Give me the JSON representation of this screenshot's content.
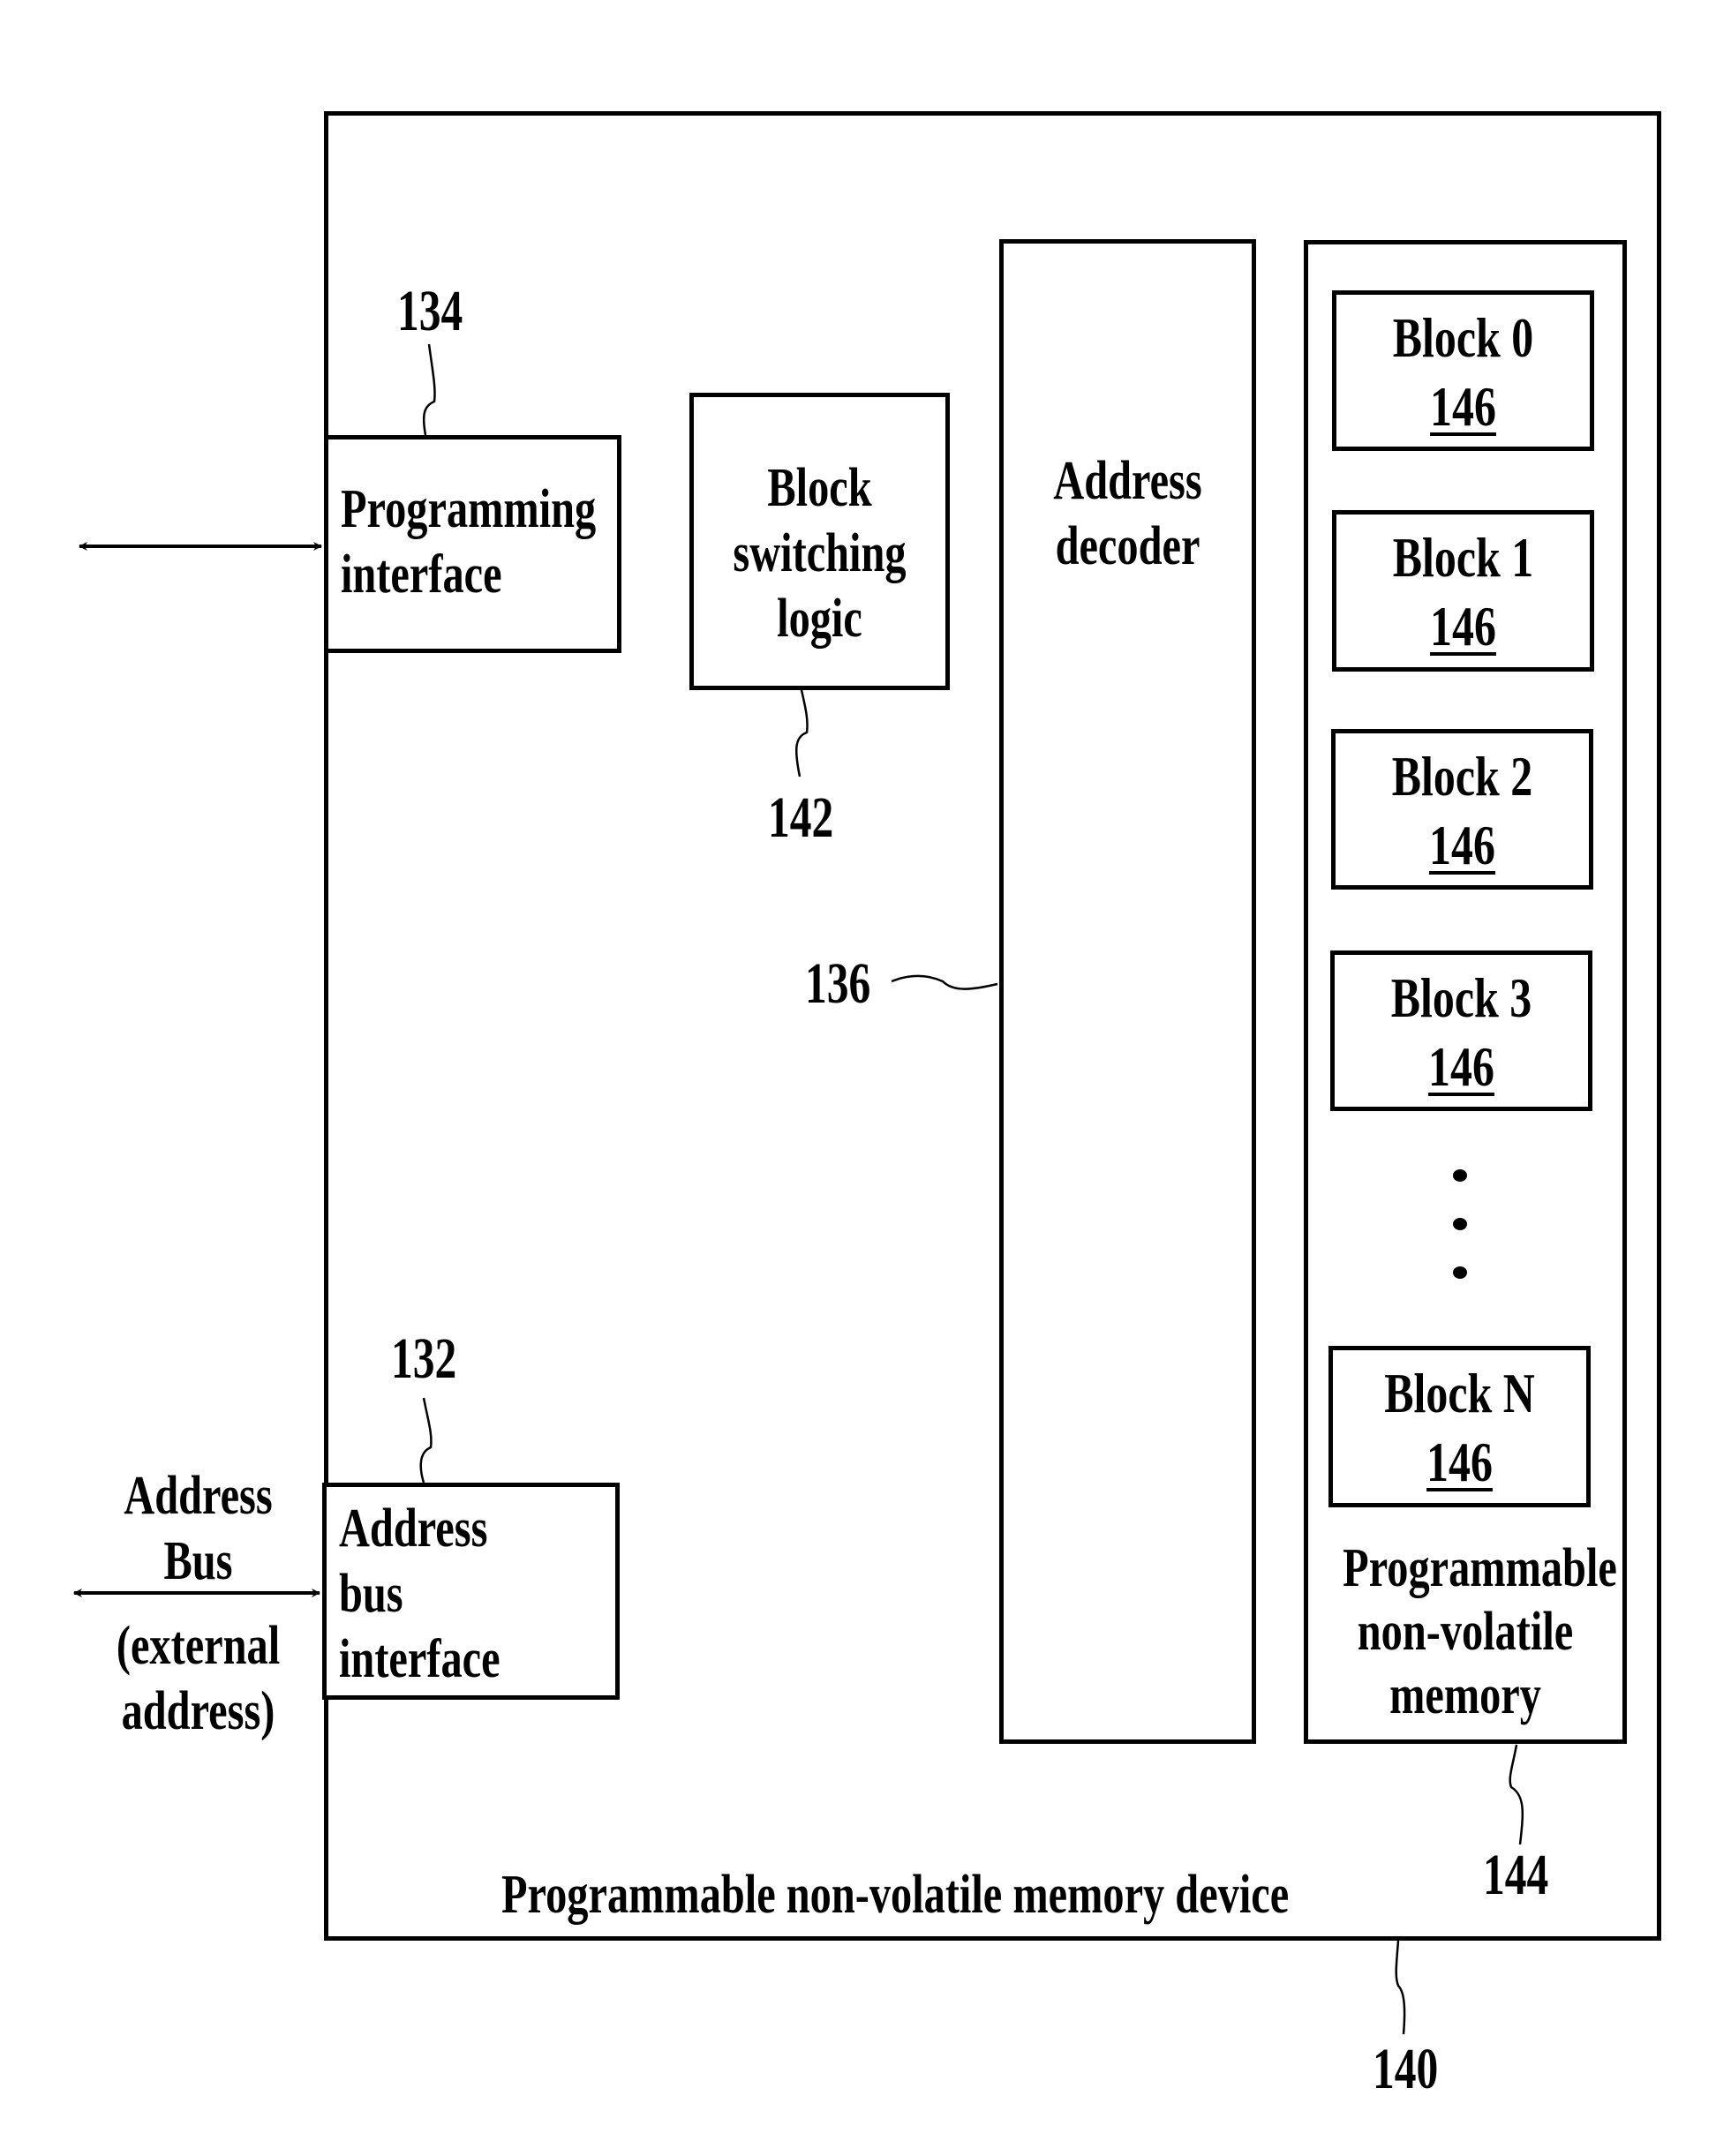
{
  "diagram": {
    "device": {
      "label": "Programmable non-volatile memory device",
      "ref": "140"
    },
    "programming_interface": {
      "lines": [
        "Programming",
        "interface"
      ],
      "ref": "134"
    },
    "block_switching_logic": {
      "lines": [
        "Block",
        "switching",
        "logic"
      ],
      "ref": "142"
    },
    "address_decoder": {
      "lines": [
        "Address",
        "decoder"
      ],
      "ref": "136"
    },
    "memory": {
      "lines": [
        "Programmable",
        "non-volatile",
        "memory"
      ],
      "ref": "144",
      "blocks": [
        {
          "name": "Block 0",
          "ref": "146"
        },
        {
          "name": "Block 1",
          "ref": "146"
        },
        {
          "name": "Block 2",
          "ref": "146"
        },
        {
          "name": "Block 3",
          "ref": "146"
        },
        {
          "name": "Block N",
          "ref": "146"
        }
      ],
      "ellipsis": "vertical-ellipsis"
    },
    "address_bus_interface": {
      "lines": [
        "Address",
        "bus",
        "interface"
      ],
      "ref": "132"
    },
    "external_address_bus": {
      "lines_above": [
        "Address",
        "Bus"
      ],
      "lines_below": [
        "(external",
        "address)"
      ]
    },
    "arrows": [
      "bidirectional-arrow-programming",
      "bidirectional-arrow-address-bus"
    ]
  }
}
